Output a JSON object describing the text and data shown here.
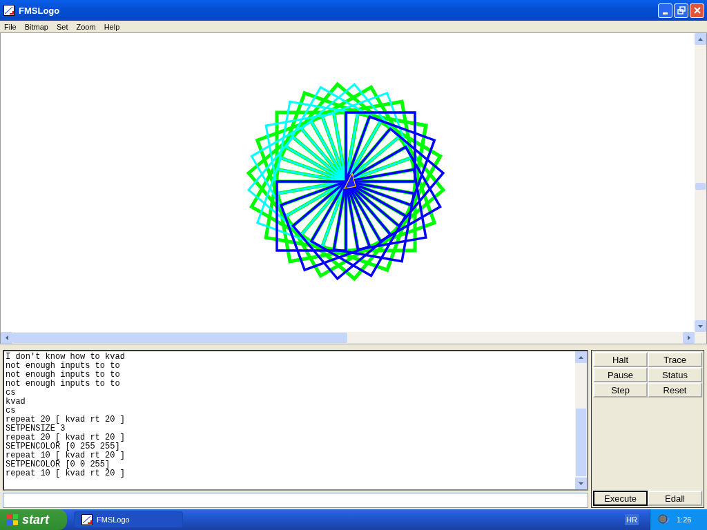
{
  "window": {
    "title": "FMSLogo"
  },
  "menu": [
    "File",
    "Bitmap",
    "Set",
    "Zoom",
    "Help"
  ],
  "output_lines": [
    "I don't know how to kvad",
    "not enough inputs to to",
    "not enough inputs to to",
    "not enough inputs to to",
    "cs",
    "kvad",
    "cs",
    "repeat 20 [ kvad rt 20 ]",
    "SETPENSIZE 3",
    "repeat 20 [ kvad rt 20 ]",
    "SETPENCOLOR [0 255 255]",
    "repeat 10 [ kvad rt 20 ]",
    "SETPENCOLOR [0 0 255]",
    "repeat 10 [ kvad rt 20 ]"
  ],
  "control_buttons": [
    "Halt",
    "Trace",
    "Pause",
    "Status",
    "Step",
    "Reset"
  ],
  "command_buttons": [
    "Execute",
    "Edall"
  ],
  "taskbar": {
    "start": "start",
    "task": "FMSLogo",
    "language": "HR",
    "clock": "1:26"
  }
}
